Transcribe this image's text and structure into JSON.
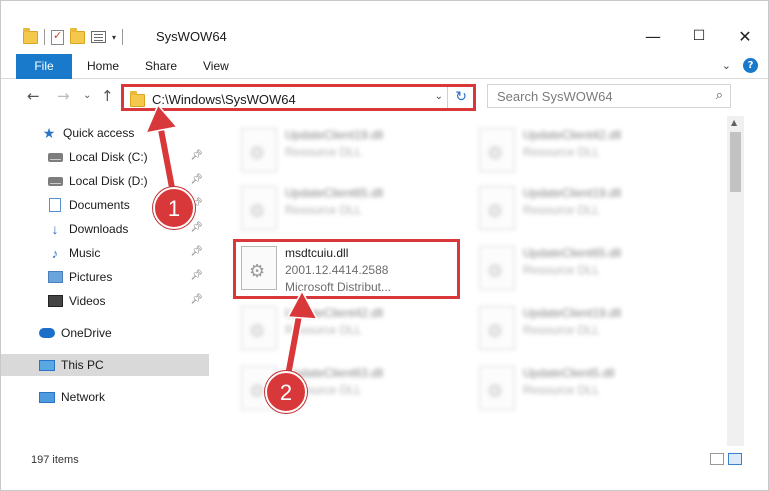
{
  "window": {
    "title": "SysWOW64",
    "controls": [
      "—",
      "☐",
      "✕"
    ]
  },
  "ribbon": {
    "tabs": [
      "File",
      "Home",
      "Share",
      "View"
    ],
    "expand_icon": "chevron-down-icon",
    "help_label": "?"
  },
  "nav": {
    "back_icon": "←",
    "forward_icon": "→",
    "recent_icon": "⌄",
    "up_icon": "↑"
  },
  "address": {
    "path": "C:\\Windows\\SysWOW64",
    "dropdown_icon": "⌄",
    "refresh_icon": "↻"
  },
  "search": {
    "placeholder": "Search SysWOW64",
    "icon": "⌕"
  },
  "sidebar": {
    "items": [
      {
        "label": "Quick access",
        "icon": "star-icon",
        "pinned": false
      },
      {
        "label": "Local Disk (C:)",
        "icon": "disk-icon",
        "pinned": true
      },
      {
        "label": "Local Disk (D:)",
        "icon": "disk-icon",
        "pinned": true
      },
      {
        "label": "Documents",
        "icon": "documents-icon",
        "pinned": true
      },
      {
        "label": "Downloads",
        "icon": "downloads-icon",
        "pinned": true
      },
      {
        "label": "Music",
        "icon": "music-icon",
        "pinned": true
      },
      {
        "label": "Pictures",
        "icon": "pictures-icon",
        "pinned": true
      },
      {
        "label": "Videos",
        "icon": "videos-icon",
        "pinned": true
      },
      {
        "label": "OneDrive",
        "icon": "onedrive-icon",
        "pinned": false
      },
      {
        "label": "This PC",
        "icon": "pc-icon",
        "pinned": false,
        "selected": true
      },
      {
        "label": "Network",
        "icon": "network-icon",
        "pinned": false
      }
    ]
  },
  "files": [
    {
      "name": "UpdateClient19.dll",
      "desc": "Resource DLL",
      "blurred": true
    },
    {
      "name": "UpdateClient42.dll",
      "desc": "Resource DLL",
      "blurred": true
    },
    {
      "name": "UpdateClient65.dll",
      "desc": "Resource DLL",
      "blurred": true
    },
    {
      "name": "UpdateClient19.dll",
      "desc": "Resource DLL",
      "blurred": true
    },
    {
      "name": "msdtcuiu.dll",
      "version": "2001.12.4414.2588",
      "desc": "Microsoft Distribut...",
      "blurred": false
    },
    {
      "name": "UpdateClient65.dll",
      "desc": "Resource DLL",
      "blurred": true
    },
    {
      "name": "UpdateClient42.dll",
      "desc": "Resource DLL",
      "blurred": true
    },
    {
      "name": "UpdateClient19.dll",
      "desc": "Resource DLL",
      "blurred": true
    },
    {
      "name": "UpdateClient63.dll",
      "desc": "Resource DLL",
      "blurred": true
    },
    {
      "name": "UpdateClient5.dll",
      "desc": "Resource DLL",
      "blurred": true
    }
  ],
  "status": {
    "count": "197 items"
  },
  "annotations": {
    "step1": "1",
    "step2": "2",
    "color": "#d9383a"
  }
}
